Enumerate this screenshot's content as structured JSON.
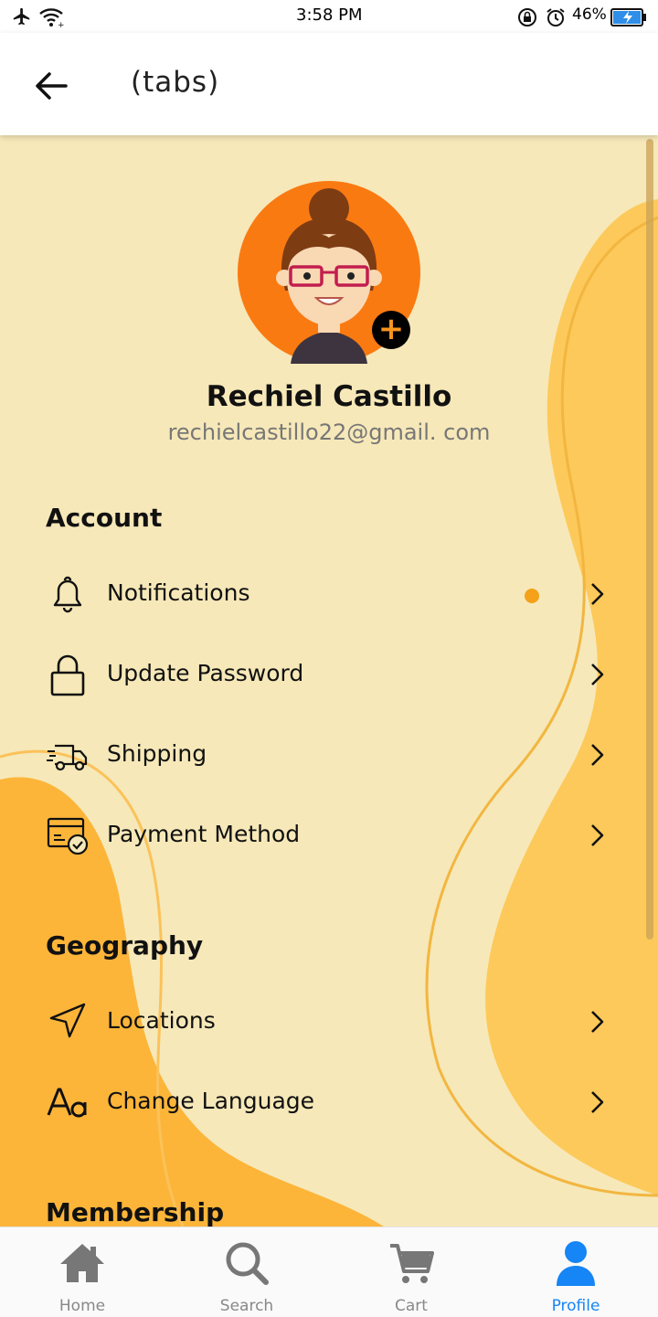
{
  "status_bar": {
    "time": "3:58 PM",
    "battery": "46%"
  },
  "header": {
    "title": "(tabs)"
  },
  "profile": {
    "name": "Rechiel Castillo",
    "email": "rechielcastillo22@gmail. com"
  },
  "sections": {
    "account": {
      "title": "Account",
      "items": [
        {
          "label": "Notifications",
          "icon": "bell-icon",
          "has_dot": true
        },
        {
          "label": "Update Password",
          "icon": "lock-icon"
        },
        {
          "label": "Shipping",
          "icon": "truck-icon"
        },
        {
          "label": "Payment Method",
          "icon": "payment-card-icon"
        }
      ]
    },
    "geography": {
      "title": "Geography",
      "items": [
        {
          "label": "Locations",
          "icon": "navigation-arrow-icon"
        },
        {
          "label": "Change Language",
          "icon": "font-aa-icon"
        }
      ]
    },
    "membership": {
      "title": "Membership"
    }
  },
  "tab_bar": {
    "tabs": [
      {
        "label": "Home",
        "icon": "home-icon"
      },
      {
        "label": "Search",
        "icon": "search-icon"
      },
      {
        "label": "Cart",
        "icon": "cart-icon"
      },
      {
        "label": "Profile",
        "icon": "person-icon",
        "active": true
      }
    ]
  },
  "colors": {
    "background": "#f6e8b8",
    "accent": "#f7931e",
    "blob": "#fcb539",
    "active_tab": "#1685f5",
    "dot": "#f5a11a"
  }
}
